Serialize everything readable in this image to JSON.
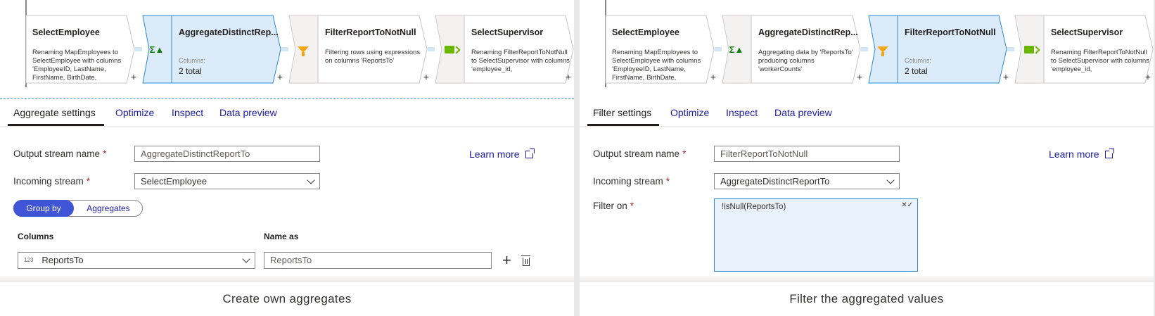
{
  "left": {
    "nodes": [
      {
        "title": "SelectEmployee",
        "desc": "Renaming MapEmployees to SelectEmployee with columns 'EmployeeID, LastName, FirstName, BirthDate,",
        "icon": "none"
      },
      {
        "title": "AggregateDistinctRep...",
        "meta_label": "Columns:",
        "meta_value": "2 total",
        "icon": "sigma-icon"
      },
      {
        "title": "FilterReportToNotNull",
        "desc": "Filtering rows using expressions on columns 'ReportsTo'",
        "icon": "funnel-icon"
      },
      {
        "title": "SelectSupervisor",
        "desc": "Renaming FilterReportToNotNull to SelectSupervisor with columns 'employee_id,",
        "icon": "select-icon"
      }
    ],
    "plus": "+",
    "tabs": [
      "Aggregate settings",
      "Optimize",
      "Inspect",
      "Data preview"
    ],
    "output_label": "Output stream name",
    "output_value": "AggregateDistinctReportTo",
    "incoming_label": "Incoming stream",
    "incoming_value": "SelectEmployee",
    "learn_more": "Learn more",
    "toggle": {
      "group_by": "Group by",
      "aggregates": "Aggregates"
    },
    "columns_header": "Columns",
    "name_as_header": "Name as",
    "column_type": "123",
    "column_value": "ReportsTo",
    "name_as_value": "ReportsTo",
    "caption": "Create own aggregates"
  },
  "right": {
    "nodes": [
      {
        "title": "SelectEmployee",
        "desc": "Renaming MapEmployees to SelectEmployee with columns 'EmployeeID, LastName, FirstName, BirthDate,",
        "icon": "none"
      },
      {
        "title": "AggregateDistinctRep...",
        "desc": "Aggregating data by 'ReportsTo' producing columns 'workerCounts'",
        "icon": "sigma-icon"
      },
      {
        "title": "FilterReportToNotNull",
        "meta_label": "Columns:",
        "meta_value": "2 total",
        "icon": "funnel-icon"
      },
      {
        "title": "SelectSupervisor",
        "desc": "Renaming FilterReportToNotNull to SelectSupervisor with columns 'employee_id,",
        "icon": "select-icon"
      }
    ],
    "plus": "+",
    "tabs": [
      "Filter settings",
      "Optimize",
      "Inspect",
      "Data preview"
    ],
    "output_label": "Output stream name",
    "output_value": "FilterReportToNotNull",
    "incoming_label": "Incoming stream",
    "incoming_value": "AggregateDistinctReportTo",
    "filter_label": "Filter on",
    "filter_value": "!isNull(ReportsTo)",
    "learn_more": "Learn more",
    "caption": "Filter the aggregated values"
  },
  "required_mark": "*",
  "sigma": "Σ▲"
}
